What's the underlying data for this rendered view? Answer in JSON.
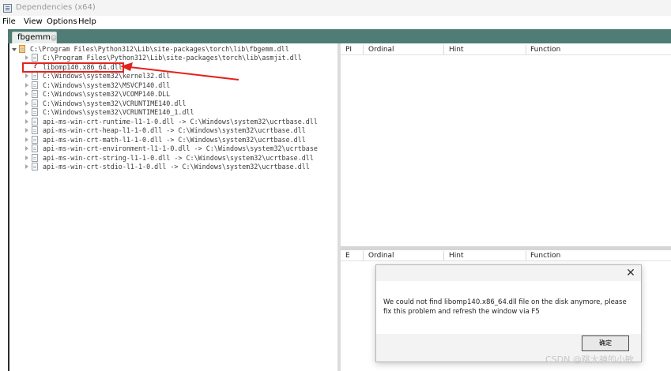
{
  "window": {
    "title": "Dependencies (x64)"
  },
  "menu": [
    "File",
    "View",
    "Options",
    "Help"
  ],
  "tabs": [
    {
      "label": "fbgemm"
    }
  ],
  "tree": {
    "rows": [
      {
        "text": "C:\\Program Files\\Python312\\Lib\\site-packages\\torch\\lib\\fbgemm.dll",
        "kind": "root",
        "expanded": true
      },
      {
        "text": "C:\\Program Files\\Python312\\Lib\\site-packages\\torch\\lib\\asmjit.dll",
        "kind": "dll"
      },
      {
        "text": "libomp140.x86_64.dll",
        "kind": "missing"
      },
      {
        "text": "C:\\Windows\\system32\\kernel32.dll",
        "kind": "dll"
      },
      {
        "text": "C:\\Windows\\system32\\MSVCP140.dll",
        "kind": "dll"
      },
      {
        "text": "C:\\Windows\\system32\\VCOMP140.DLL",
        "kind": "dll"
      },
      {
        "text": "C:\\Windows\\system32\\VCRUNTIME140.dll",
        "kind": "dll"
      },
      {
        "text": "C:\\Windows\\system32\\VCRUNTIME140_1.dll",
        "kind": "dll"
      },
      {
        "text": "api-ms-win-crt-runtime-l1-1-0.dll -> C:\\Windows\\system32\\ucrtbase.dll",
        "kind": "dll"
      },
      {
        "text": "api-ms-win-crt-heap-l1-1-0.dll -> C:\\Windows\\system32\\ucrtbase.dll",
        "kind": "dll"
      },
      {
        "text": "api-ms-win-crt-math-l1-1-0.dll -> C:\\Windows\\system32\\ucrtbase.dll",
        "kind": "dll"
      },
      {
        "text": "api-ms-win-crt-environment-l1-1-0.dll -> C:\\Windows\\system32\\ucrtbase",
        "kind": "dll"
      },
      {
        "text": "api-ms-win-crt-string-l1-1-0.dll -> C:\\Windows\\system32\\ucrtbase.dll",
        "kind": "dll"
      },
      {
        "text": "api-ms-win-crt-stdio-l1-1-0.dll -> C:\\Windows\\system32\\ucrtbase.dll",
        "kind": "dll"
      }
    ],
    "missing_marker": "?"
  },
  "imports_table": {
    "columns": [
      "PI",
      "Ordinal",
      "Hint",
      "Function"
    ]
  },
  "exports_table": {
    "columns": [
      "E",
      "Ordinal",
      "Hint",
      "Function"
    ]
  },
  "dialog": {
    "message": "We could not find libomp140.x86_64.dll file on the disk anymore, please fix this problem and refresh the window via F5",
    "ok_label": "确定",
    "close_glyph": "✕"
  },
  "watermark": "CSDN @跳大神的小敏",
  "colors": {
    "annotation": "#e3221c",
    "tab_strip": "#4f7c74"
  }
}
